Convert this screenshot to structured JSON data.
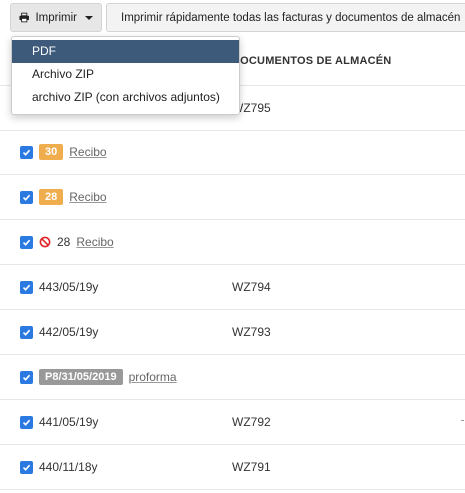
{
  "toolbar": {
    "print_label": "Imprimir",
    "quick_print_label": "Imprimir rápidamente todas las facturas y documentos de almacén"
  },
  "dropdown": {
    "items": [
      "PDF",
      "Archivo ZIP",
      "archivo ZIP (con archivos adjuntos)"
    ],
    "highlighted": "PDF"
  },
  "table": {
    "doc_column_header": "DOCUMENTOS DE ALMACÉN",
    "rows": [
      {
        "mid": "WZ795"
      },
      {
        "badge": "30",
        "link": "Recibo"
      },
      {
        "badge": "28",
        "link": "Recibo"
      },
      {
        "number": "28",
        "link": "Recibo"
      },
      {
        "left": "443/05/19y",
        "mid": "WZ794"
      },
      {
        "left": "442/05/19y",
        "mid": "WZ793"
      },
      {
        "badge": "P8/31/05/2019",
        "link": "proforma"
      },
      {
        "left": "441/05/19y",
        "mid": "WZ792"
      },
      {
        "left": "440/11/18y",
        "mid": "WZ791"
      }
    ]
  },
  "colors": {
    "checkbox": "#2a7ae2",
    "badge_orange": "#f0ad4e",
    "badge_grey": "#999999",
    "dropdown_highlight": "#3d5a7a",
    "ban_icon": "#e0262b"
  },
  "icons": {
    "print": "printer-icon",
    "dropdown": "caret-down-icon",
    "checkbox": "check-icon",
    "cancelled": "ban-icon"
  }
}
